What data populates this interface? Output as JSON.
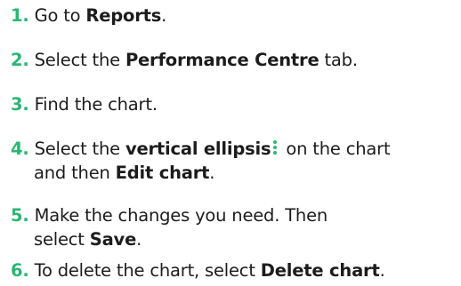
{
  "steps": [
    {
      "num": "1.",
      "parts": [
        "Go to ",
        "Reports",
        "."
      ]
    },
    {
      "num": "2.",
      "parts": [
        "Select the ",
        "Performance Centre",
        " tab."
      ]
    },
    {
      "num": "3.",
      "parts": [
        "Find the chart."
      ]
    },
    {
      "num": "4.",
      "parts": [
        "Select the ",
        "vertical ellipsis",
        " on the chart",
        "and then ",
        "Edit chart",
        "."
      ],
      "icon": "vertical-ellipsis-icon"
    },
    {
      "num": "5.",
      "parts": [
        "Make the changes you need. Then",
        "select ",
        "Save",
        "."
      ]
    },
    {
      "num": "6.",
      "parts": [
        "To delete the chart, select ",
        "Delete chart",
        "."
      ]
    }
  ],
  "colors": {
    "accent": "#2bb673",
    "text": "#1c1c1c"
  }
}
